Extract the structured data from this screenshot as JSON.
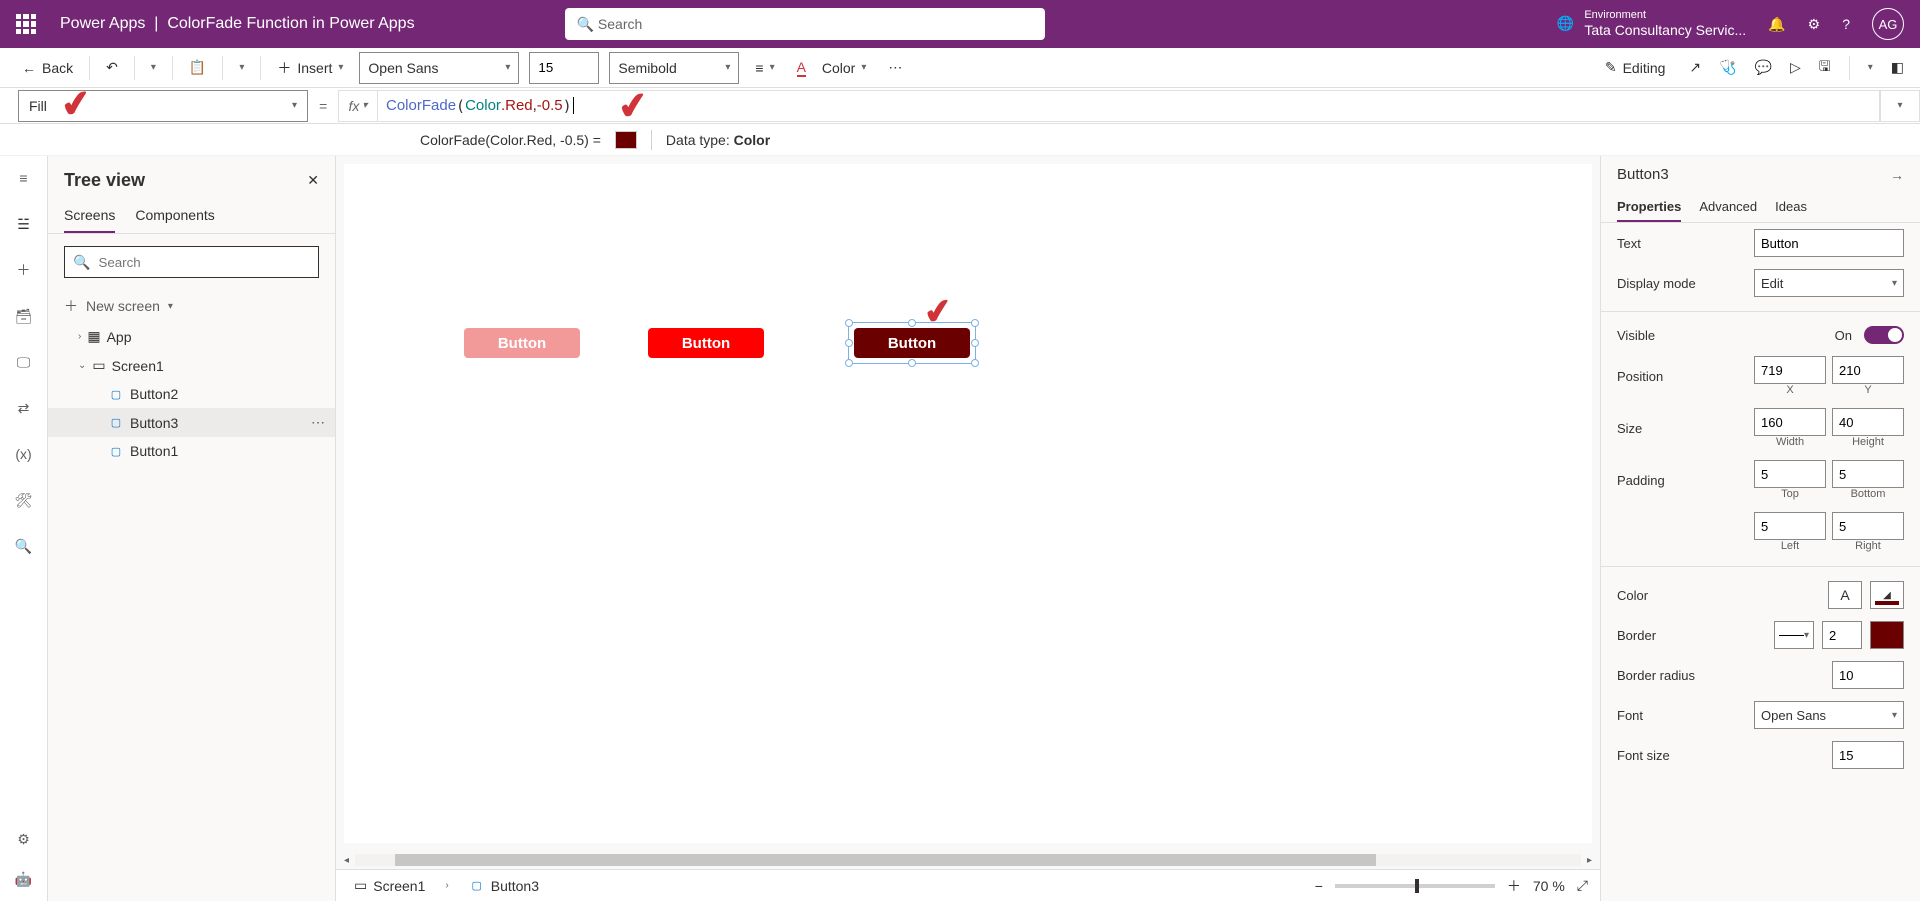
{
  "header": {
    "app": "Power Apps",
    "doc": "ColorFade Function in Power Apps",
    "search_placeholder": "Search",
    "env_label": "Environment",
    "env_name": "Tata Consultancy Servic...",
    "avatar": "AG"
  },
  "toolbar": {
    "back": "Back",
    "insert": "Insert",
    "font": "Open Sans",
    "font_size": "15",
    "font_weight": "Semibold",
    "color": "Color",
    "editing": "Editing"
  },
  "formula": {
    "property": "Fill",
    "expr_fn": "ColorFade",
    "expr_obj": "Color",
    "expr_prop": ".Red",
    "expr_rest": ", ",
    "expr_num": "-0.5",
    "result_label": "ColorFade(Color.Red, -0.5)  =",
    "data_type_label": "Data type: ",
    "data_type": "Color"
  },
  "tree": {
    "title": "Tree view",
    "tabs": {
      "screens": "Screens",
      "components": "Components"
    },
    "search_placeholder": "Search",
    "new_screen": "New screen",
    "app": "App",
    "screen1": "Screen1",
    "items": [
      "Button2",
      "Button3",
      "Button1"
    ]
  },
  "canvas": {
    "button_text": "Button",
    "breadcrumb_screen": "Screen1",
    "breadcrumb_ctrl": "Button3",
    "zoom": "70  %"
  },
  "props": {
    "name": "Button3",
    "tabs": {
      "properties": "Properties",
      "advanced": "Advanced",
      "ideas": "Ideas"
    },
    "text_label": "Text",
    "text_value": "Button",
    "display_mode_label": "Display mode",
    "display_mode_value": "Edit",
    "visible_label": "Visible",
    "visible_value": "On",
    "position_label": "Position",
    "pos_x": "719",
    "pos_y": "210",
    "x": "X",
    "y": "Y",
    "size_label": "Size",
    "width": "160",
    "height": "40",
    "w": "Width",
    "h": "Height",
    "padding_label": "Padding",
    "pad_t": "5",
    "pad_b": "5",
    "pad_l": "5",
    "pad_r": "5",
    "top": "Top",
    "bottom": "Bottom",
    "left": "Left",
    "right": "Right",
    "color_label": "Color",
    "border_label": "Border",
    "border_w": "2",
    "radius_label": "Border radius",
    "radius": "10",
    "font_label": "Font",
    "font_value": "Open Sans",
    "font_size_label": "Font size",
    "font_size_value": "15"
  }
}
